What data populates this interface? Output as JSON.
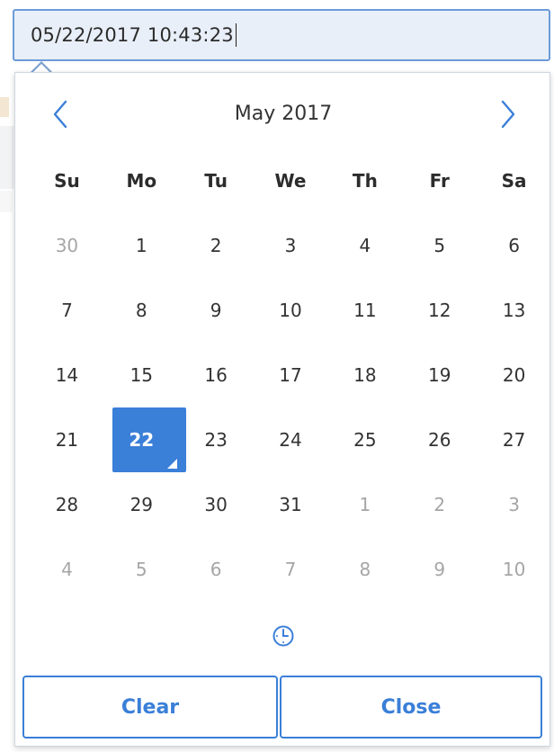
{
  "input": {
    "value": "05/22/2017 10:43:23"
  },
  "calendar": {
    "month_title": "May 2017",
    "prev_icon": "chevron-left-icon",
    "next_icon": "chevron-right-icon",
    "weekdays": [
      "Su",
      "Mo",
      "Tu",
      "We",
      "Th",
      "Fr",
      "Sa"
    ],
    "weeks": [
      [
        "30",
        "1",
        "2",
        "3",
        "4",
        "5",
        "6"
      ],
      [
        "7",
        "8",
        "9",
        "10",
        "11",
        "12",
        "13"
      ],
      [
        "14",
        "15",
        "16",
        "17",
        "18",
        "19",
        "20"
      ],
      [
        "21",
        "22",
        "23",
        "24",
        "25",
        "26",
        "27"
      ],
      [
        "28",
        "29",
        "30",
        "31",
        "1",
        "2",
        "3"
      ],
      [
        "4",
        "5",
        "6",
        "7",
        "8",
        "9",
        "10"
      ]
    ],
    "selected_day": "22",
    "time_icon": "clock-icon"
  },
  "buttons": {
    "clear_label": "Clear",
    "close_label": "Close"
  },
  "colors": {
    "accent": "#3a7fd8",
    "input_bg": "#e9eff8",
    "muted_text": "#a6a6a6"
  }
}
